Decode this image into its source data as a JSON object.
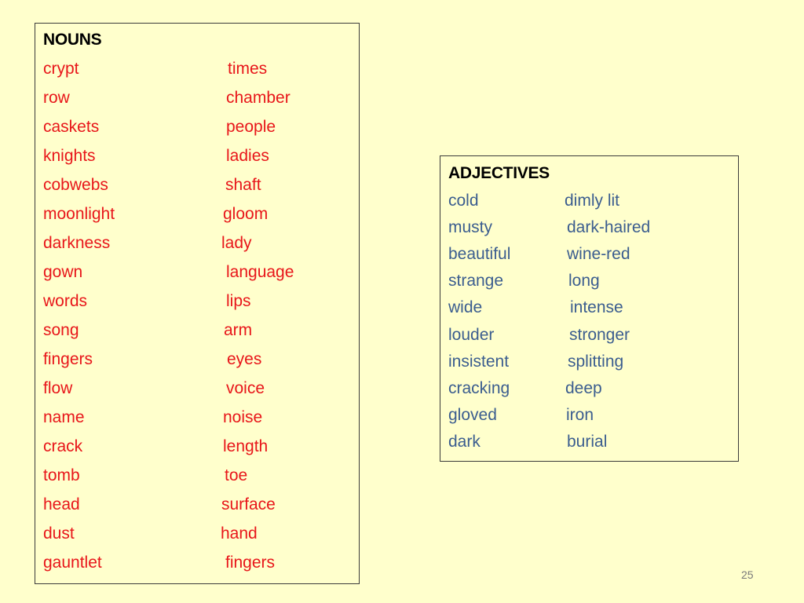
{
  "slide": {
    "page_number": "25",
    "colors": {
      "background": "#ffffcc",
      "noun_text": "#e8161a",
      "adjective_text": "#3b5d8f",
      "heading_text": "#000000"
    }
  },
  "nouns": {
    "heading": "NOUNS",
    "left_column": [
      "crypt",
      "row",
      "caskets",
      "knights",
      "cobwebs",
      "moonlight",
      "darkness",
      "gown",
      "words",
      "song",
      "fingers",
      "flow",
      "name",
      "crack",
      "tomb",
      "head",
      "dust",
      "gauntlet"
    ],
    "right_column": [
      "times",
      "chamber",
      "people",
      "ladies",
      "shaft",
      "gloom",
      "lady",
      "language",
      "lips",
      "arm",
      "eyes",
      "voice",
      "noise",
      "length",
      "toe",
      "surface",
      "hand",
      "fingers"
    ]
  },
  "adjectives": {
    "heading": "ADJECTIVES",
    "left_column": [
      "cold",
      "musty",
      "beautiful",
      "strange",
      "wide",
      "louder",
      "insistent",
      "cracking",
      "gloved",
      "dark"
    ],
    "right_column": [
      "dimly lit",
      "dark-haired",
      "wine-red",
      "long",
      "intense",
      "stronger",
      "splitting",
      "deep",
      "iron",
      "burial"
    ]
  }
}
